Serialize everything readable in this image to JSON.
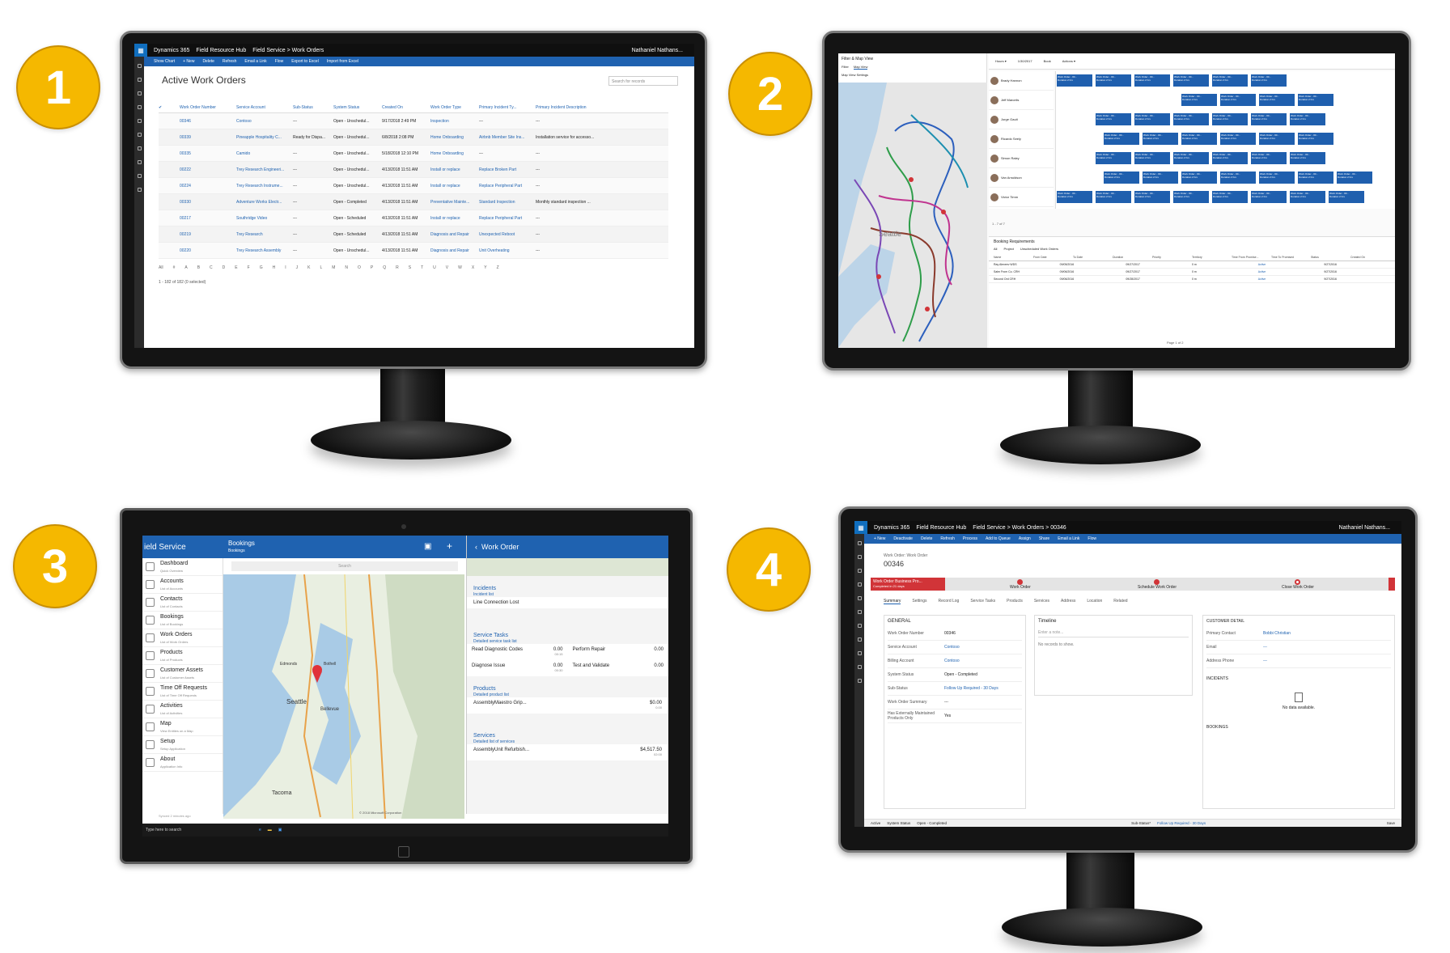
{
  "badges": [
    "1",
    "2",
    "3",
    "4"
  ],
  "screen1": {
    "app": "Dynamics 365",
    "hub": "Field Resource Hub",
    "breadcrumb": "Field Service  >  Work Orders",
    "user": "Nathaniel Nathans...",
    "commands": [
      "Show Chart",
      "+ New",
      "Delete",
      "Refresh",
      "Email a Link",
      "Flow",
      "Export to Excel",
      "Import from Excel"
    ],
    "view_title": "Active Work Orders",
    "search_placeholder": "Search for records",
    "columns": [
      "Work Order Number",
      "Service Account",
      "Sub-Status",
      "System Status",
      "Created On",
      "Work Order Type",
      "Primary Incident Ty...",
      "Primary Incident Description"
    ],
    "rows": [
      [
        "00346",
        "Contoso",
        "---",
        "Open - Unschedul...",
        "9/17/2018 2:49 PM",
        "Inspection",
        "---",
        "---"
      ],
      [
        "00339",
        "Pineapple Hospitality C...",
        "Ready for Dispa...",
        "Open - Unschedul...",
        "6/8/2018 2:08 PM",
        "Home Onboarding",
        "Airbnb Member Site Ins...",
        "Installation service for accesso..."
      ],
      [
        "00335",
        "Camido",
        "---",
        "Open - Unschedul...",
        "5/18/2018 12:10 PM",
        "Home Onboarding",
        "---",
        "---"
      ],
      [
        "00222",
        "Trey Research Engineeri...",
        "---",
        "Open - Unschedul...",
        "4/13/2018 11:51 AM",
        "Install or replace",
        "Replace Broken Part",
        "---"
      ],
      [
        "00224",
        "Trey Research Instrume...",
        "---",
        "Open - Unschedul...",
        "4/13/2018 11:51 AM",
        "Install or replace",
        "Replace Peripheral Part",
        "---"
      ],
      [
        "00330",
        "Adventure Works Electr...",
        "---",
        "Open - Completed",
        "4/13/2018 11:51 AM",
        "Preventative Mainte...",
        "Standard Inspection",
        "Monthly standard inspection ..."
      ],
      [
        "00217",
        "Southridge Video",
        "---",
        "Open - Scheduled",
        "4/13/2018 11:51 AM",
        "Install or replace",
        "Replace Peripheral Part",
        "---"
      ],
      [
        "00219",
        "Trey Research",
        "---",
        "Open - Scheduled",
        "4/13/2018 11:51 AM",
        "Diagnosis and Repair",
        "Unexpected Reboot",
        "---"
      ],
      [
        "00220",
        "Trey Research Assembly",
        "---",
        "Open - Unschedul...",
        "4/13/2018 11:51 AM",
        "Diagnosis and Repair",
        "Unit Overheating",
        "---"
      ]
    ],
    "alphabet": [
      "All",
      "#",
      "A",
      "B",
      "C",
      "D",
      "E",
      "F",
      "G",
      "H",
      "I",
      "J",
      "K",
      "L",
      "M",
      "N",
      "O",
      "P",
      "Q",
      "R",
      "S",
      "T",
      "U",
      "V",
      "W",
      "X",
      "Y",
      "Z"
    ],
    "footer": "1 - 182 of 182 (0 selected)"
  },
  "screen2": {
    "left_title": "Filter & Map View",
    "left_tabs": [
      "Filter",
      "Map View"
    ],
    "map_settings": "Map View Settings",
    "map_city": "Seattle",
    "resources": [
      "Brady Hannon",
      "Jeff Marcelis",
      "Jorge Gault",
      "Ricardo Seely",
      "Simon Raley",
      "Van Arnuldson",
      "Victor Timm"
    ],
    "block_label": "Work Order - 00...",
    "block_sub": "Duration 2 hrs",
    "date": "1/30/2017",
    "pager": "1 - 7 of 7",
    "requirements_title": "Booking Requirements",
    "req_tabs": [
      "All",
      "Project",
      "Unscheduled Work Orders"
    ],
    "req_columns": [
      "Name",
      "From Date",
      "To Date",
      "Duration",
      "Priority",
      "Territory",
      "Time From Promise...",
      "Time To Promised",
      "Status",
      "Created On"
    ],
    "req_rows": [
      [
        "Ray Alexeev WDS",
        "09/05/2016",
        "09/27/2017",
        "0 m",
        "Active",
        "9/27/2016"
      ],
      [
        "Salm From Co. CRH",
        "09/06/2016",
        "09/27/2017",
        "0 m",
        "Active",
        "9/27/2016"
      ],
      [
        "Second Ord CRH",
        "09/06/2016",
        "09/28/2017",
        "0 m",
        "Active",
        "9/27/2016"
      ]
    ],
    "page_label": "Page 1 of 2"
  },
  "screen3": {
    "app_title": "ield Service",
    "bookings_title": "Bookings",
    "bookings_sub": "Bookings",
    "search_placeholder": "Search",
    "menu": [
      {
        "label": "Dashboard",
        "sub": "Quick Overview"
      },
      {
        "label": "Accounts",
        "sub": "List of Accounts"
      },
      {
        "label": "Contacts",
        "sub": "List of Contacts"
      },
      {
        "label": "Bookings",
        "sub": "List of Bookings"
      },
      {
        "label": "Work Orders",
        "sub": "List of Work Orders"
      },
      {
        "label": "Products",
        "sub": "List of Products"
      },
      {
        "label": "Customer Assets",
        "sub": "List of Customer Assets"
      },
      {
        "label": "Time Off Requests",
        "sub": "List of Time Off Requests"
      },
      {
        "label": "Activities",
        "sub": "List of Activities"
      },
      {
        "label": "Map",
        "sub": "View Entities on a Map"
      },
      {
        "label": "Setup",
        "sub": "Setup Application"
      },
      {
        "label": "About",
        "sub": "Application Info"
      }
    ],
    "synced": "Synced 2 minutes ago",
    "map_labels": [
      "Seattle",
      "Bellevue",
      "Tacoma",
      "Bothell",
      "Edmonds"
    ],
    "copyright": "© 2018 Microsoft Corporation",
    "work_order_title": "Work Order",
    "incidents": "Incidents",
    "incident_list": "Incident list",
    "incident_item": "Line Connection Lost",
    "service_tasks": "Service Tasks",
    "task_list": "Detailed service task list",
    "tasks": [
      {
        "name": "Read Diagnostic Codes",
        "value": "0.00",
        "sub": "00:15"
      },
      {
        "name": "Perform Repair",
        "value": "0.00"
      },
      {
        "name": "Diagnose Issue",
        "value": "0.00",
        "sub": "00:30"
      },
      {
        "name": "Test and Validate",
        "value": "0.00"
      }
    ],
    "products": "Products",
    "product_list": "Detailed product list",
    "product_item": "AssemblyMaestro Grip...",
    "product_price": "$0.00",
    "product_qty": "0.00",
    "services": "Services",
    "service_list": "Detailed list of services",
    "service_item": "AssemblyUnit Refurbish...",
    "service_price": "$4,517.50",
    "service_qty": "02:00",
    "taskbar_search": "Type here to search"
  },
  "screen4": {
    "app": "Dynamics 365",
    "hub": "Field Resource Hub",
    "breadcrumb": "Field Service  >  Work Orders  >  00346",
    "user": "Nathaniel Nathans...",
    "commands": [
      "+ New",
      "Deactivate",
      "Delete",
      "Refresh",
      "Process",
      "Add to Queue",
      "Assign",
      "Share",
      "Email a Link",
      "Flow"
    ],
    "entity": "Work Order: Work Order",
    "record": "00346",
    "bpf_name": "Work Order Business Pro...",
    "bpf_sub": "Completed in 21 days",
    "stages": [
      "Work Order",
      "Schedule Work Order",
      "Close Work Order"
    ],
    "tabs": [
      "Summary",
      "Settings",
      "Record Log",
      "Service Tasks",
      "Products",
      "Services",
      "Address",
      "Location",
      "Related"
    ],
    "general": "GENERAL",
    "fields": [
      {
        "label": "Work Order Number",
        "value": "00346"
      },
      {
        "label": "Service Account",
        "value": "Contoso"
      },
      {
        "label": "Billing Account",
        "value": "Contoso"
      },
      {
        "label": "System Status",
        "value": "Open - Completed"
      },
      {
        "label": "Sub-Status",
        "value": "Follow Up Required - 30 Days"
      },
      {
        "label": "Work Order Summary",
        "value": "---"
      },
      {
        "label": "Has Externally Maintained Products Only",
        "value": "Yes"
      }
    ],
    "timeline": "Timeline",
    "note_placeholder": "Enter a note...",
    "no_records": "No records to show.",
    "customer_detail": "CUSTOMER DETAIL",
    "contact_fields": [
      {
        "label": "Primary Contact",
        "value": "Bobbi Christian"
      },
      {
        "label": "Email",
        "value": "---"
      },
      {
        "label": "Address Phone",
        "value": "---"
      }
    ],
    "incidents": "INCIDENTS",
    "no_data": "No data available.",
    "bookings": "BOOKINGS",
    "status_active": "Active",
    "status_label": "System Status",
    "status_value": "Open - Completed",
    "sub_status_label": "Sub-Status*",
    "sub_status_value": "Follow Up Required - 30 Days",
    "save": "Save"
  },
  "colors": {
    "badge": "#f5b800",
    "d365_blue": "#1f62b0",
    "bpf_red": "#d13438",
    "booking_block": "#1f5fae"
  }
}
